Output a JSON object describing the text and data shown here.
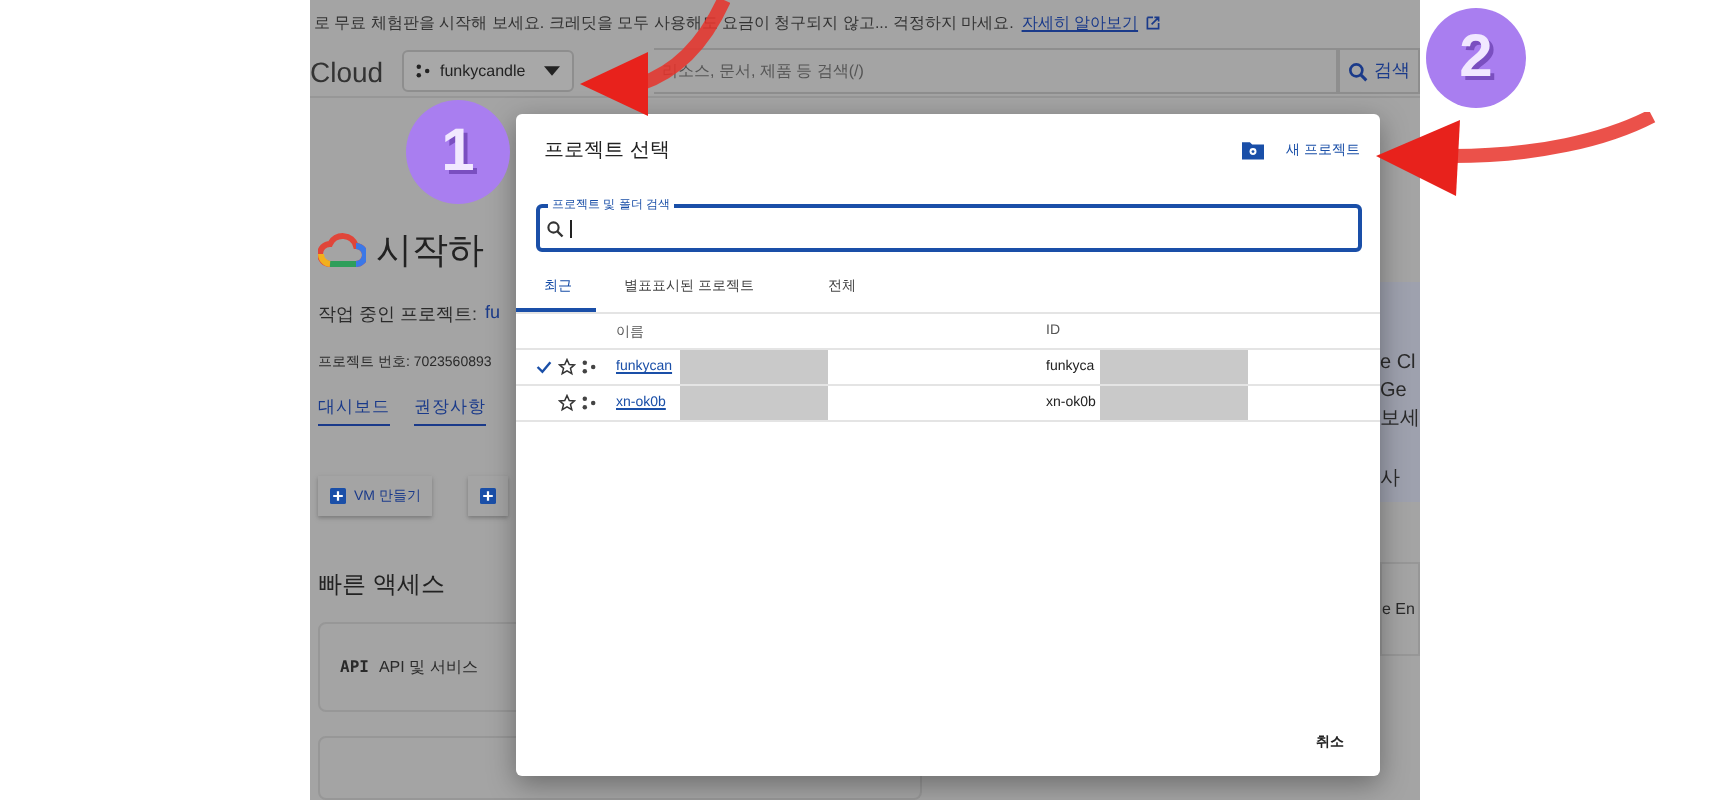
{
  "banner": {
    "text": "로 무료 체험판을 시작해 보세요. 크레딧을 모두 사용해도 요금이 청구되지 않고... 걱정하지 마세요.",
    "link": "자세히 알아보기"
  },
  "header": {
    "brand": "Cloud",
    "project": "funkycandle",
    "search_placeholder": "리소스, 문서, 제품 등 검색(/)",
    "search_button": "검색"
  },
  "page": {
    "title": "시작하",
    "working_project_label": "작업 중인 프로젝트:",
    "working_project": "fu",
    "project_number": "프로젝트 번호: 7023560893",
    "tabs": [
      {
        "label": "대시보드",
        "selected": false
      },
      {
        "label": "권장사항",
        "selected": false
      }
    ],
    "actions": [
      {
        "kind": "labeled",
        "label": "VM 만들기"
      },
      {
        "kind": "icon_only"
      }
    ],
    "quick_access_title": "빠른 액세스",
    "quick_access": [
      {
        "icon_text": "API",
        "label": "API 및 서비스"
      }
    ],
    "side_lines": [
      "e Cl",
      "Ge",
      "보세",
      "사"
    ],
    "side_bottom": "e En"
  },
  "dialog": {
    "title": "프로젝트 선택",
    "new_project": "새 프로젝트",
    "search_label": "프로젝트 및 폴더 검색",
    "tabs": [
      {
        "label": "최근",
        "selected": true
      },
      {
        "label": "별표표시된 프로젝트",
        "selected": false
      },
      {
        "label": "전체",
        "selected": false
      }
    ],
    "columns": [
      "이름",
      "ID"
    ],
    "rows": [
      {
        "current": true,
        "starred": false,
        "name": "funkycan",
        "id": "funkyca"
      },
      {
        "current": false,
        "starred": false,
        "name": "xn-ok0b",
        "id": "xn-ok0b"
      }
    ],
    "cancel": "취소"
  },
  "annotations": [
    {
      "number": "1"
    },
    {
      "number": "2"
    }
  ]
}
